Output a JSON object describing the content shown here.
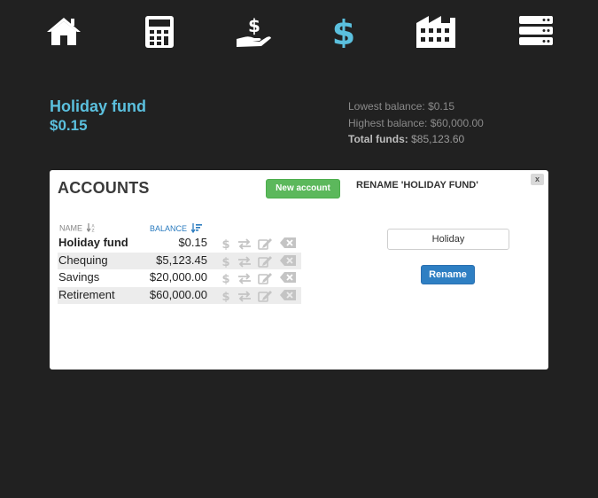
{
  "nav": [
    {
      "icon": "home-icon"
    },
    {
      "icon": "calculator-icon"
    },
    {
      "icon": "hand-dollar-icon"
    },
    {
      "icon": "dollar-icon",
      "active": true
    },
    {
      "icon": "building-icon"
    },
    {
      "icon": "server-icon"
    }
  ],
  "summary": {
    "fund_name": "Holiday fund",
    "fund_balance": "$0.15",
    "lowest_label": "Lowest balance:",
    "lowest_value": "$0.15",
    "highest_label": "Highest balance:",
    "highest_value": "$60,000.00",
    "total_label": "Total funds:",
    "total_value": "$85,123.60"
  },
  "accounts": {
    "title": "ACCOUNTS",
    "new_button": "New account",
    "col_name": "NAME",
    "col_balance": "BALANCE",
    "rows": [
      {
        "name": "Holiday fund",
        "balance": "$0.15"
      },
      {
        "name": "Chequing",
        "balance": "$5,123.45"
      },
      {
        "name": "Savings",
        "balance": "$20,000.00"
      },
      {
        "name": "Retirement",
        "balance": "$60,000.00"
      }
    ]
  },
  "rename": {
    "title": "RENAME 'HOLIDAY FUND'",
    "close": "x",
    "input_value": "Holiday",
    "button": "Rename"
  },
  "colors": {
    "background": "#212121",
    "accent": "#5bc0de",
    "new_button": "#5cb85c",
    "rename_button": "#2e7fc3"
  }
}
